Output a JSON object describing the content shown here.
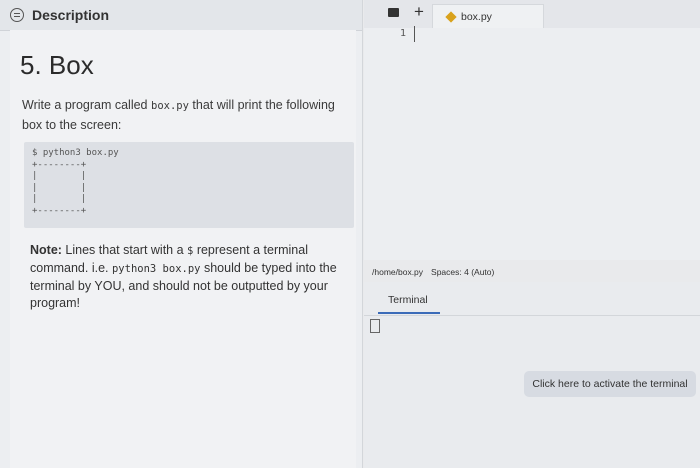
{
  "left_panel": {
    "tab_label": "Description",
    "title": "5. Box",
    "intro_pre": "Write a program called ",
    "intro_code": "box.py",
    "intro_post": " that will print the following box to the screen:",
    "code_sample": "$ python3 box.py\n+--------+\n|        |\n|        |\n|        |\n+--------+",
    "note_bold": "Note:",
    "note_1": " Lines that start with a ",
    "note_code1": "$",
    "note_2": " represent a terminal command. i.e. ",
    "note_code2": "python3 box.py",
    "note_3": " should be typed into the terminal by YOU, and should not be outputted by your program!"
  },
  "editor": {
    "add_tab": "+",
    "file_tab": "box.py",
    "line_number": "1"
  },
  "statusbar": {
    "path": "/home/box.py",
    "spaces": "Spaces: 4 (Auto)"
  },
  "terminal": {
    "tab_label": "Terminal",
    "activate_label": "Click here to activate the terminal"
  }
}
